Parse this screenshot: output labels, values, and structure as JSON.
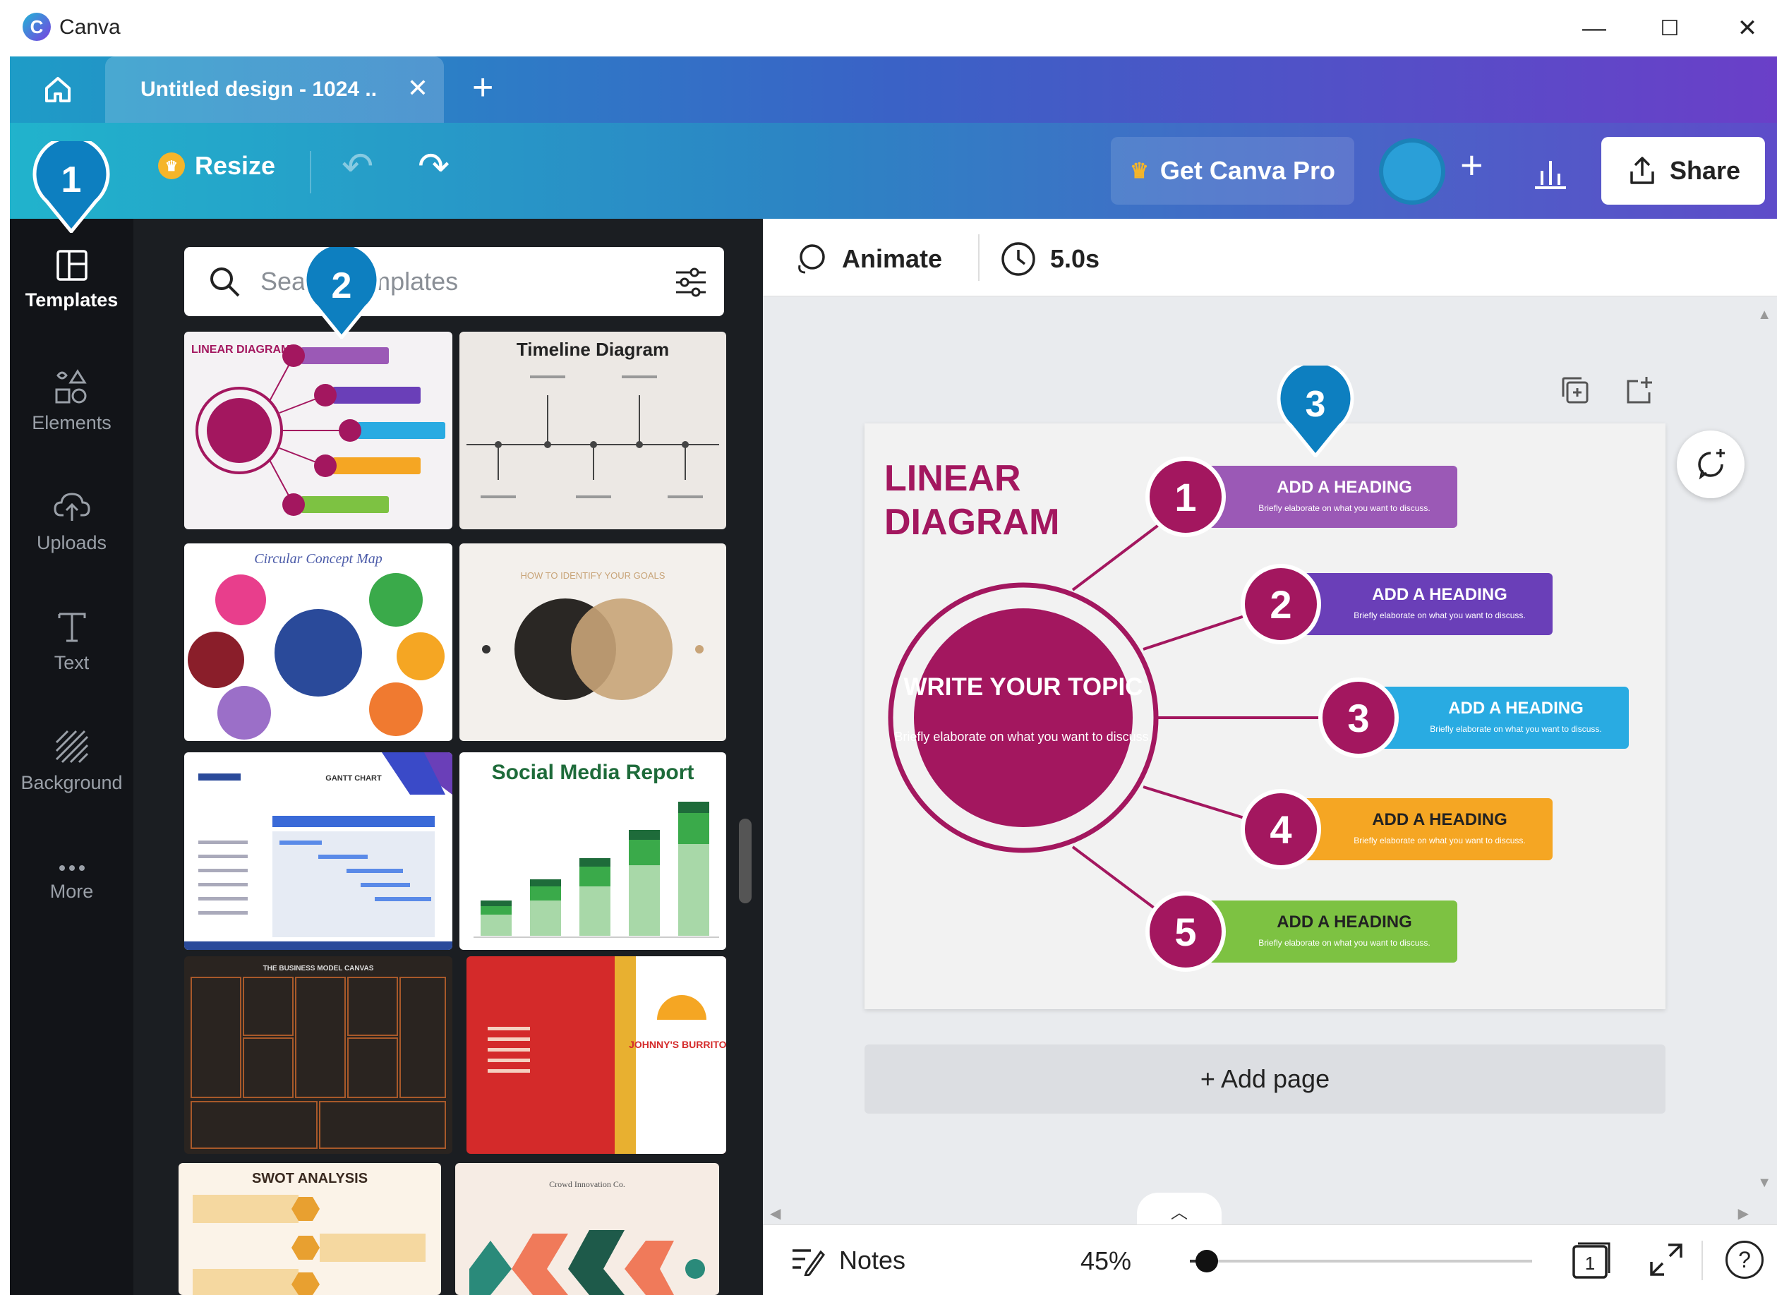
{
  "app": {
    "title": "Canva",
    "logo_letter": "C"
  },
  "window_controls": {
    "minimize": "—",
    "maximize": "☐",
    "close": "✕"
  },
  "tabs": {
    "document_tab": "Untitled design - 1024 ..",
    "close": "✕",
    "new_tab": "+"
  },
  "toolbar": {
    "resize_label": "Resize",
    "get_pro_label": "Get Canva Pro",
    "share_label": "Share",
    "avatar_color": "#2a9fd8"
  },
  "sidebar": {
    "items": [
      {
        "label": "Templates",
        "icon": "templates-icon",
        "active": true
      },
      {
        "label": "Elements",
        "icon": "elements-icon"
      },
      {
        "label": "Uploads",
        "icon": "uploads-icon"
      },
      {
        "label": "Text",
        "icon": "text-icon"
      },
      {
        "label": "Background",
        "icon": "background-icon"
      },
      {
        "label": "More",
        "icon": "more-icon"
      }
    ]
  },
  "template_panel": {
    "search_placeholder": "Search templates",
    "thumbnails": [
      {
        "title": "LINEAR DIAGRAM"
      },
      {
        "title": "Timeline Diagram"
      },
      {
        "title": "Circular Concept Map"
      },
      {
        "title": "HOW TO IDENTIFY YOUR GOALS"
      },
      {
        "title": "GANTT CHART"
      },
      {
        "title": "Social Media Report"
      },
      {
        "title": "THE BUSINESS MODEL CANVAS"
      },
      {
        "title": "JOHNNY'S BURRITOS"
      },
      {
        "title": "SWOT ANALYSIS"
      },
      {
        "title": "Crowd Innovation Co."
      }
    ]
  },
  "editor": {
    "animate_label": "Animate",
    "duration": "5.0s",
    "add_page_label": "+ Add page",
    "canvas": {
      "title_line1": "LINEAR",
      "title_line2": "DIAGRAM",
      "center_title": "WRITE YOUR TOPIC",
      "center_sub": "Briefly elaborate on what you want to discuss.",
      "items": [
        {
          "num": "1",
          "heading": "ADD A HEADING",
          "sub": "Briefly elaborate on what you want to discuss.",
          "color": "#9b59b6"
        },
        {
          "num": "2",
          "heading": "ADD A HEADING",
          "sub": "Briefly elaborate on what you want to discuss.",
          "color": "#6a3fb8"
        },
        {
          "num": "3",
          "heading": "ADD A HEADING",
          "sub": "Briefly elaborate on what you want to discuss.",
          "color": "#29abe2"
        },
        {
          "num": "4",
          "heading": "ADD A HEADING",
          "sub": "Briefly elaborate on what you want to discuss.",
          "color": "#f5a623"
        },
        {
          "num": "5",
          "heading": "ADD A HEADING",
          "sub": "Briefly elaborate on what you want to discuss.",
          "color": "#7dc242"
        }
      ],
      "accent": "#a3175f"
    }
  },
  "bottom_bar": {
    "notes_label": "Notes",
    "zoom": "45%",
    "zoom_fraction": 0.05,
    "page_number": "1",
    "help": "?"
  },
  "callouts": [
    "1",
    "2",
    "3"
  ]
}
